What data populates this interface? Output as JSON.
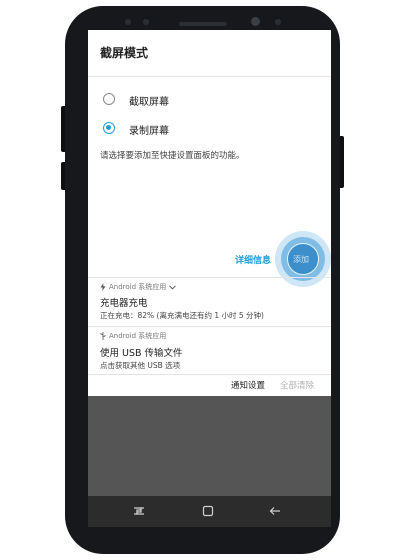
{
  "dialog": {
    "title": "截屏模式",
    "options": [
      {
        "label": "截取屏幕",
        "selected": false
      },
      {
        "label": "录制屏幕",
        "selected": true
      }
    ],
    "hint": "请选择要添加至快捷设置面板的功能。",
    "details_label": "详细信息",
    "add_label": "添加",
    "accent_color": "#1f9fd6"
  },
  "notifications": [
    {
      "source": "Android 系统应用",
      "source_icon": "lightning-icon",
      "expand_icon": "chevron-down-icon",
      "title": "充电器充电",
      "body": "正在充电：82% (离充满电还有约 1 小时 5 分钟)"
    },
    {
      "source": "Android 系统应用",
      "source_icon": "usb-icon",
      "title": "使用 USB 传输文件",
      "body": "点击获取其他 USB 选项"
    }
  ],
  "notification_actions": {
    "settings_label": "通知设置",
    "clear_all_label": "全部清除"
  },
  "navbar": {
    "icons": [
      "recent-apps-icon",
      "home-icon",
      "back-icon"
    ]
  }
}
